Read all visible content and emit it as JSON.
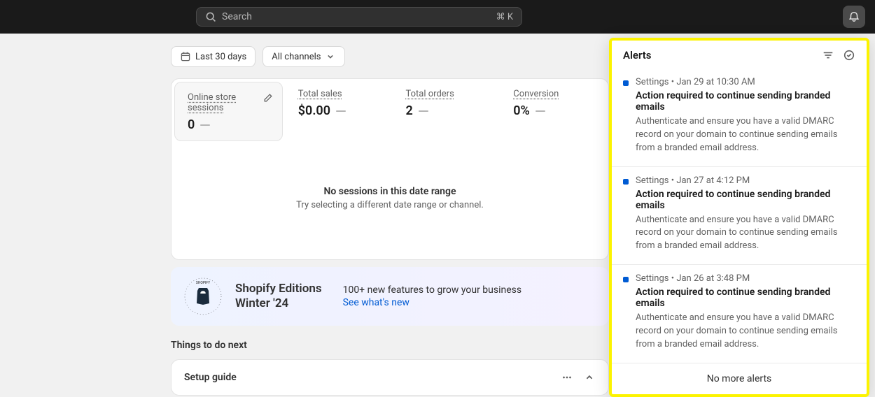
{
  "search": {
    "placeholder": "Search",
    "shortcut": "⌘ K"
  },
  "filters": {
    "date": "Last 30 days",
    "channel": "All channels"
  },
  "stats": [
    {
      "label": "Online store sessions",
      "value": "0",
      "editable": true
    },
    {
      "label": "Total sales",
      "value": "$0.00"
    },
    {
      "label": "Total orders",
      "value": "2"
    },
    {
      "label": "Conversion",
      "value": "0%"
    }
  ],
  "empty": {
    "title": "No sessions in this date range",
    "sub": "Try selecting a different date range or channel."
  },
  "promo": {
    "title1": "Shopify Editions",
    "title2": "Winter '24",
    "desc": "100+ new features to grow your business",
    "link": "See what's new"
  },
  "next": {
    "heading": "Things to do next",
    "setup": "Setup guide"
  },
  "alerts": {
    "title": "Alerts",
    "items": [
      {
        "source": "Settings",
        "time": "Jan 29 at 10:30 AM",
        "title": "Action required to continue sending branded emails",
        "desc": "Authenticate and ensure you have a valid DMARC record on your domain to continue sending emails from a branded email address."
      },
      {
        "source": "Settings",
        "time": "Jan 27 at 4:12 PM",
        "title": "Action required to continue sending branded emails",
        "desc": "Authenticate and ensure you have a valid DMARC record on your domain to continue sending emails from a branded email address."
      },
      {
        "source": "Settings",
        "time": "Jan 26 at 3:48 PM",
        "title": "Action required to continue sending branded emails",
        "desc": "Authenticate and ensure you have a valid DMARC record on your domain to continue sending emails from a branded email address."
      }
    ],
    "footer": "No more alerts"
  }
}
